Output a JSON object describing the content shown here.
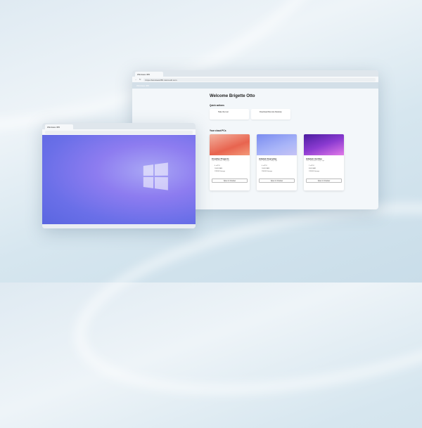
{
  "browser": {
    "tab_title": "Windows 365",
    "url": "https://windows365.microsoft.com",
    "app_title": "Windows 365"
  },
  "main": {
    "welcome": "Welcome Brigette Otto",
    "quick_actions_title": "Quick actions",
    "quick_actions": [
      {
        "label": "Take the tour"
      },
      {
        "label": "Download Remote Desktop"
      }
    ],
    "cloud_pcs_title": "Your cloud PCs",
    "cloud_pcs": [
      {
        "name": "Creative Projects",
        "sub": "Last connected 1 day ago",
        "cpu": "4 vCPU",
        "ram": "16GB RAM",
        "storage": "128GB Storage",
        "button": "Open in browser",
        "gradient": "linear-gradient(160deg,#f3b3a0,#e8644f 60%,#f39a7a)"
      },
      {
        "name": "Adatum Everyday",
        "sub": "Last connected 3 days ago",
        "cpu": "4 vCPU",
        "ram": "16GB RAM",
        "storage": "256GB Storage",
        "button": "Open in browser",
        "gradient": "linear-gradient(160deg,#7a8cf0,#a9b5f8 60%,#c6c3f5)"
      },
      {
        "name": "Adatum Archive",
        "sub": "Last connected 5 days ago",
        "cpu": "2 vCPU",
        "ram": "8GB RAM",
        "storage": "128GB Storage",
        "button": "Open in browser",
        "gradient": "linear-gradient(160deg,#4b1ea0,#8a3ad0 50%,#e27ae8)"
      }
    ]
  },
  "vm": {
    "tab_title": "Windows 365"
  }
}
